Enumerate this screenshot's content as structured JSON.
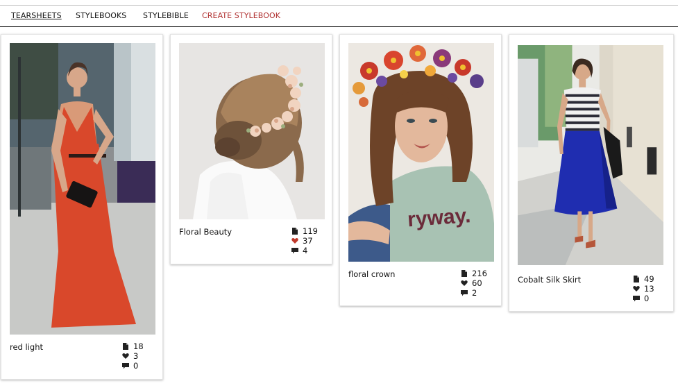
{
  "nav": {
    "tearsheets": "TEARSHEETS",
    "stylebooks": "STYLEBOOKS",
    "stylebible": "STYLEBIBLE",
    "create": "CREATE STYLEBOOK"
  },
  "colors": {
    "accent": "#b03030",
    "liked_heart": "#c0392b",
    "icon": "#222222"
  },
  "cards": [
    {
      "title": "red light",
      "pages": "18",
      "likes": "3",
      "comments": "0",
      "liked": false
    },
    {
      "title": "Floral Beauty",
      "pages": "119",
      "likes": "37",
      "comments": "4",
      "liked": true
    },
    {
      "title": "floral crown",
      "pages": "216",
      "likes": "60",
      "comments": "2",
      "liked": false
    },
    {
      "title": "Cobalt Silk Skirt",
      "pages": "49",
      "likes": "13",
      "comments": "0",
      "liked": false
    }
  ],
  "icons": {
    "pages": "document-icon",
    "likes": "heart-icon",
    "comments": "comment-icon"
  }
}
